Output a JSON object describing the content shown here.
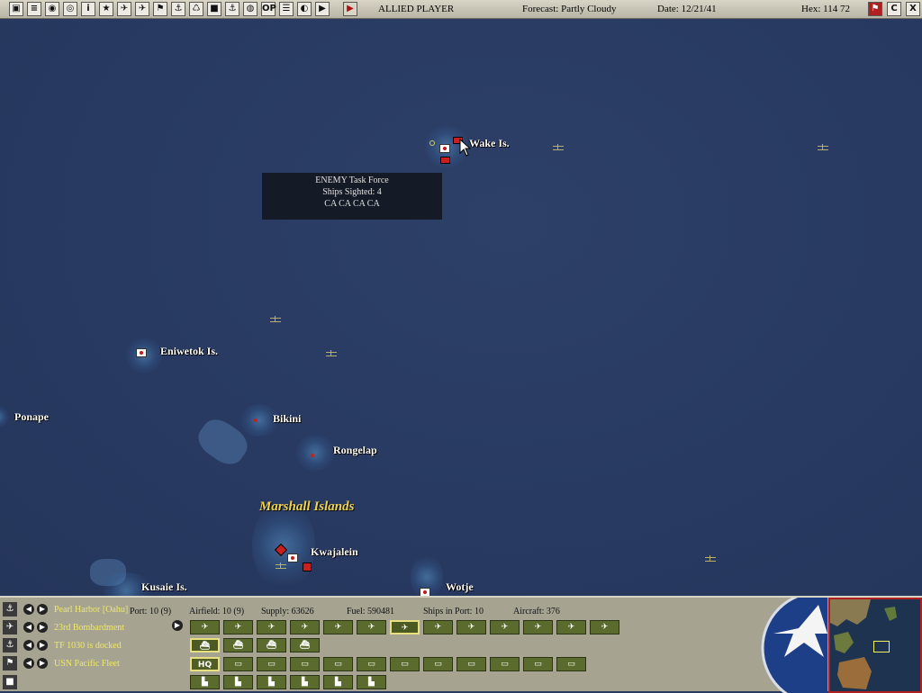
{
  "topbar": {
    "player": "ALLIED PLAYER",
    "forecast": "Forecast: Partly Cloudy",
    "date": "Date: 12/21/41",
    "hex": "Hex: 114 72",
    "icons": [
      "new-game-icon",
      "document-icon",
      "save-icon",
      "load-icon",
      "info-icon",
      "objectives-icon",
      "air-units-icon",
      "aircraft-icon",
      "flag-icon",
      "ground-icon",
      "production-icon",
      "allies-icon",
      "ships-icon",
      "globe-icon",
      "options-icon",
      "op-report-icon",
      "list-icon",
      "combat-report-icon",
      "end-turn-icon"
    ],
    "right_icons": [
      "flag-menu-icon",
      "c-icon",
      "close-icon"
    ],
    "right_icon_labels": [
      "",
      "C",
      "X"
    ]
  },
  "map": {
    "places": [
      {
        "name": "Wake Is."
      },
      {
        "name": "Eniwetok Is."
      },
      {
        "name": "Ponape"
      },
      {
        "name": "Bikini"
      },
      {
        "name": "Rongelap"
      },
      {
        "name": "Kwajalein"
      },
      {
        "name": "Kusaie Is."
      },
      {
        "name": "Wotje"
      }
    ],
    "region_label": "Marshall Islands",
    "tooltip": {
      "line1": "ENEMY Task Force",
      "line2": "Ships Sighted: 4",
      "line3": "CA CA CA CA"
    }
  },
  "panel": {
    "rows": [
      {
        "icon": "anchor-icon",
        "text": "Pearl Harbor [Oahu]"
      },
      {
        "icon": "air-icon",
        "text": "23rd Bombardment"
      },
      {
        "icon": "ship-icon",
        "text": "TF 1030 is docked"
      },
      {
        "icon": "flag-icon",
        "text": "USN Pacific Fleet"
      }
    ],
    "stats": {
      "port": "Port: 10 (9)",
      "airfield": "Airfield: 10 (9)",
      "supply": "Supply: 63626",
      "fuel": "Fuel: 590481",
      "ships": "Ships in Port: 10",
      "aircraft": "Aircraft: 376"
    },
    "hq_label": "HQ",
    "colors": {
      "panel": "#a6a491",
      "button": "#5b6b2e",
      "highlight": "#efe86a"
    }
  }
}
